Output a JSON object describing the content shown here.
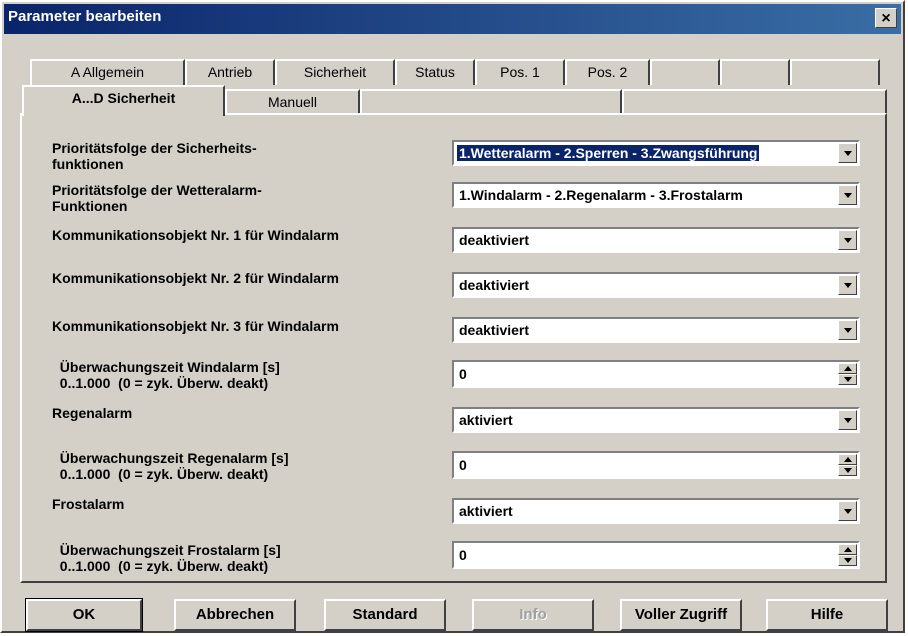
{
  "window": {
    "title": "Parameter bearbeiten",
    "close_label": "×"
  },
  "tabs_row1": [
    "A  Allgemein",
    "Antrieb",
    "Sicherheit",
    "Status",
    "Pos. 1",
    "Pos. 2",
    "",
    "",
    "",
    ""
  ],
  "tabs_row2": [
    "A...D   Sicherheit",
    "Manuell",
    "",
    ""
  ],
  "params": [
    {
      "label": "Prioritätsfolge der Sicherheits-\nfunktionen",
      "type": "select",
      "value": "1.Wetteralarm - 2.Sperren - 3.Zwangsführung",
      "focused": true
    },
    {
      "label": "Prioritätsfolge der Wetteralarm-\nFunktionen",
      "type": "select",
      "value": "1.Windalarm - 2.Regenalarm - 3.Frostalarm"
    },
    {
      "label": "Kommunikationsobjekt Nr. 1 für Windalarm",
      "type": "select",
      "value": "deaktiviert"
    },
    {
      "label": "Kommunikationsobjekt Nr. 2 für Windalarm",
      "type": "select",
      "value": "deaktiviert"
    },
    {
      "label": "Kommunikationsobjekt Nr. 3 für Windalarm",
      "type": "select",
      "value": "deaktiviert"
    },
    {
      "label": "  Überwachungszeit Windalarm [s]\n  0..1.000  (0 = zyk. Überw. deakt)",
      "type": "spin",
      "value": "0"
    },
    {
      "label": "Regenalarm",
      "type": "select",
      "value": "aktiviert"
    },
    {
      "label": "  Überwachungszeit Regenalarm [s]\n  0..1.000  (0 = zyk. Überw. deakt)",
      "type": "spin",
      "value": "0"
    },
    {
      "label": "Frostalarm",
      "type": "select",
      "value": "aktiviert"
    },
    {
      "label": "  Überwachungszeit Frostalarm [s]\n  0..1.000  (0 = zyk. Überw. deakt)",
      "type": "spin",
      "value": "0"
    }
  ],
  "buttons": {
    "ok": "OK",
    "cancel": "Abbrechen",
    "standard": "Standard",
    "info": "Info",
    "full_access": "Voller Zugriff",
    "help": "Hilfe"
  }
}
